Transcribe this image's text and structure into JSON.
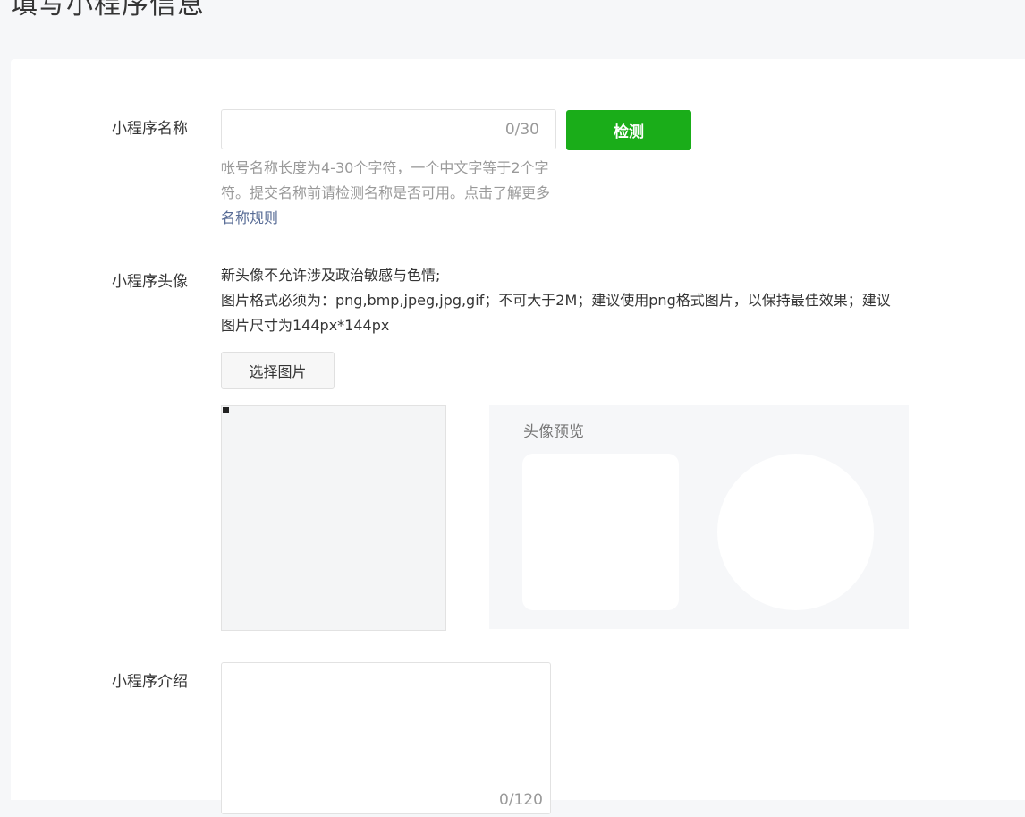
{
  "page": {
    "title": "填写小程序信息"
  },
  "name_section": {
    "label": "小程序名称",
    "input_value": "",
    "input_placeholder": "",
    "counter": "0/30",
    "check_button": "检测",
    "tip_text": "帐号名称长度为4-30个字符，一个中文字等于2个字符。提交名称前请检测名称是否可用。点击了解更多",
    "tip_link": "名称规则"
  },
  "avatar_section": {
    "label": "小程序头像",
    "tip_line1": "新头像不允许涉及政治敏感与色情;",
    "tip_line2": "图片格式必须为：png,bmp,jpeg,jpg,gif；不可大于2M；建议使用png格式图片，以保持最佳效果；建议图片尺寸为144px*144px",
    "choose_button": "选择图片",
    "preview_title": "头像预览"
  },
  "intro_section": {
    "label": "小程序介绍",
    "input_value": "",
    "counter": "0/120"
  },
  "colors": {
    "primary_green": "#1aad19",
    "link_blue": "#576b95",
    "tip_gray": "#9a9a9a",
    "page_bg": "#f6f7f9"
  }
}
